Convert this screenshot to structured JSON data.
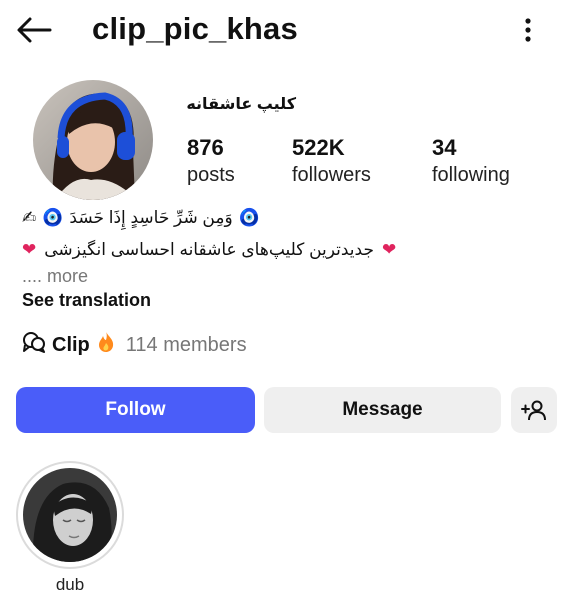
{
  "header": {
    "username": "clip_pic_khas"
  },
  "profile": {
    "display_name": "کلیپ عاشقانه",
    "stats": [
      {
        "value": "876",
        "label": "posts"
      },
      {
        "value": "522K",
        "label": "followers"
      },
      {
        "value": "34",
        "label": "following"
      }
    ],
    "bio": {
      "line1": "وَمِن شَرِّ حَاسِدٍ إِذَا حَسَدَ",
      "line2": "جدیدترین کلیپ‌های عاشقانه احساسی انگیزشی",
      "more": ".... more",
      "see_translation": "See translation"
    },
    "channel": {
      "name": "Clip",
      "members": "114 members"
    }
  },
  "actions": {
    "follow": "Follow",
    "message": "Message"
  },
  "highlights": [
    {
      "label": "dub"
    }
  ],
  "colors": {
    "accent": "#4a5df9",
    "secondary_button": "#efefef",
    "muted_text": "#777777"
  },
  "icons": [
    "back-arrow-icon",
    "more-options-icon",
    "writing-hand-emoji",
    "nazar-amulet-emoji",
    "red-heart-emoji",
    "channel-bubbles-icon",
    "fire-emoji",
    "add-person-icon"
  ]
}
